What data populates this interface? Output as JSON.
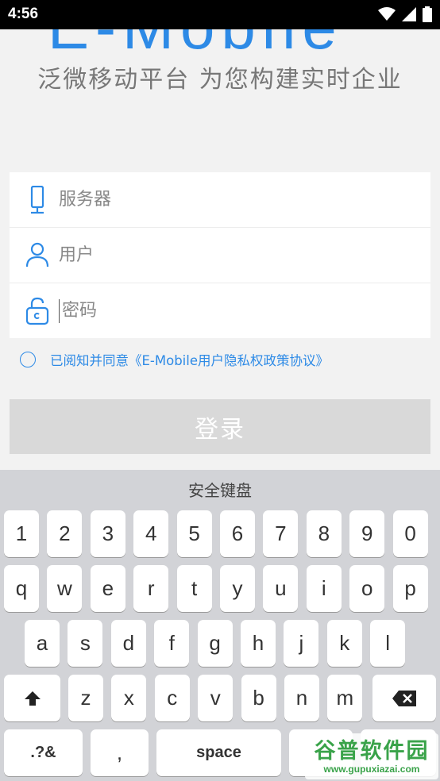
{
  "status_bar": {
    "time": "4:56"
  },
  "logo": {
    "brand_text": "E-Mobile",
    "tagline": "泛微移动平台 为您构建实时企业"
  },
  "form": {
    "server_placeholder": "服务器",
    "user_placeholder": "用户",
    "password_placeholder": "密码"
  },
  "agreement": {
    "text": "已阅知并同意《E-Mobile用户隐私权政策协议》"
  },
  "login_button": {
    "label": "登录"
  },
  "keyboard": {
    "title": "安全键盘",
    "row1": [
      "1",
      "2",
      "3",
      "4",
      "5",
      "6",
      "7",
      "8",
      "9",
      "0"
    ],
    "row2": [
      "q",
      "w",
      "e",
      "r",
      "t",
      "y",
      "u",
      "i",
      "o",
      "p"
    ],
    "row3": [
      "a",
      "s",
      "d",
      "f",
      "g",
      "h",
      "j",
      "k",
      "l"
    ],
    "row4": [
      "z",
      "x",
      "c",
      "v",
      "b",
      "n",
      "m"
    ],
    "symbols_label": ".?&",
    "comma_label": ",",
    "space_label": "space"
  },
  "watermark": {
    "title": "谷普软件园",
    "url": "www.gupuxiazai.com"
  },
  "colors": {
    "accent": "#2d8ae6",
    "button_disabled": "#d9d9d9",
    "keyboard_bg": "#d2d3d7"
  }
}
